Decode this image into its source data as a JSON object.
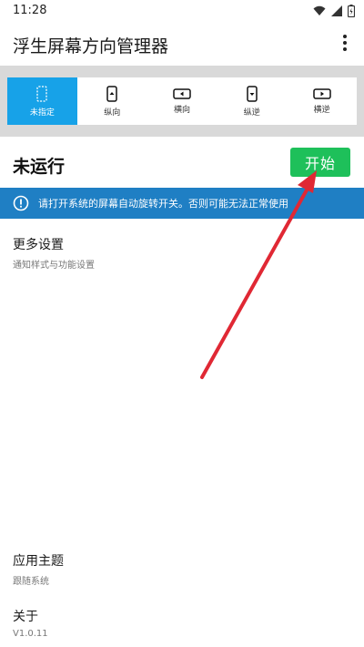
{
  "status_bar": {
    "time": "11:28"
  },
  "app_bar": {
    "title": "浮生屏幕方向管理器"
  },
  "modes": [
    {
      "label": "未指定",
      "icon": "unspecified-icon",
      "selected": true
    },
    {
      "label": "纵向",
      "icon": "portrait-icon",
      "selected": false
    },
    {
      "label": "横向",
      "icon": "landscape-icon",
      "selected": false
    },
    {
      "label": "纵逆",
      "icon": "reverse-portrait-icon",
      "selected": false
    },
    {
      "label": "横逆",
      "icon": "reverse-landscape-icon",
      "selected": false
    }
  ],
  "service": {
    "state": "未运行",
    "start_label": "开始"
  },
  "warning": {
    "text": "请打开系统的屏幕自动旋转开关。否则可能无法正常使用"
  },
  "settings": {
    "more": {
      "title": "更多设置",
      "subtitle": "通知样式与功能设置"
    },
    "theme": {
      "title": "应用主题",
      "subtitle": "跟随系统"
    },
    "about": {
      "title": "关于",
      "subtitle": "V1.0.11"
    }
  },
  "colors": {
    "accent": "#17a2e8",
    "start_button": "#1ec05a",
    "warning_banner": "#1f7fc4",
    "annotation_arrow": "#e02834"
  }
}
